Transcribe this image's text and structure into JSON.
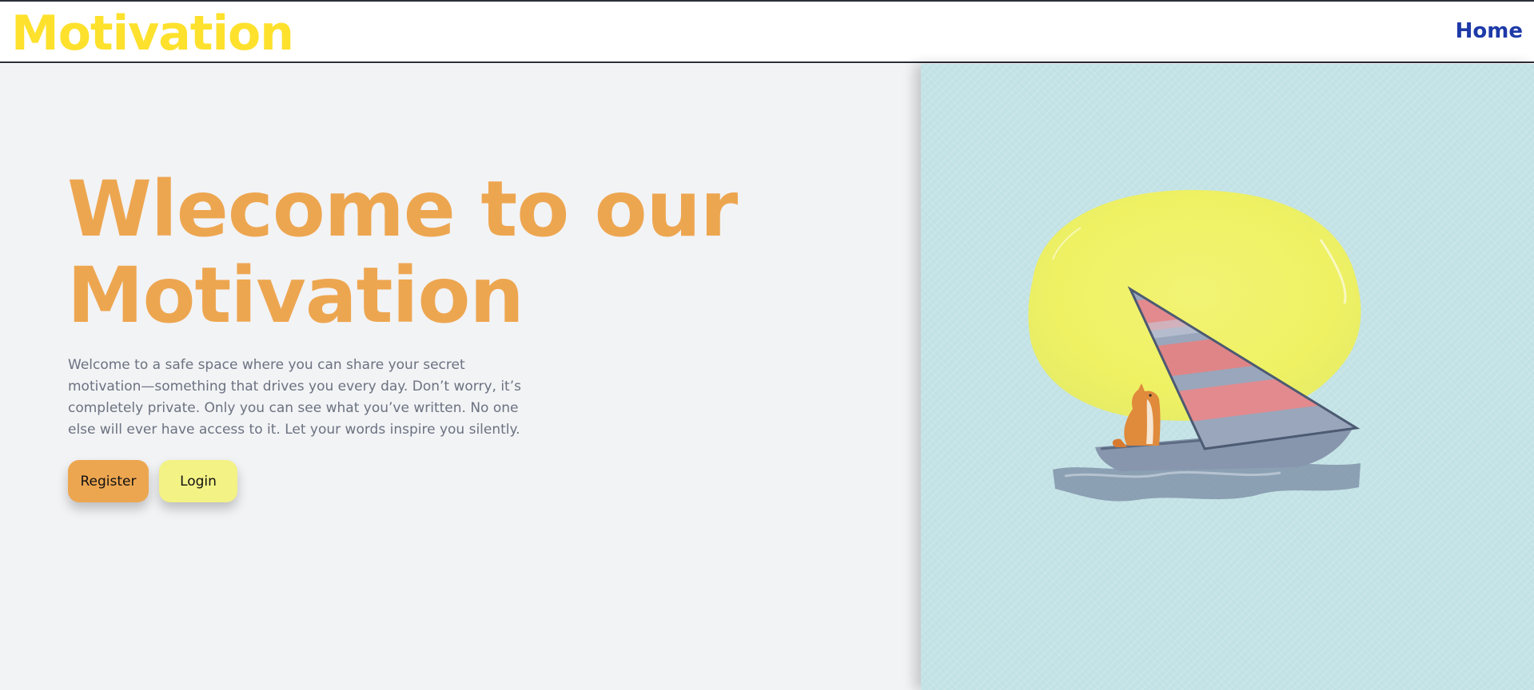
{
  "header": {
    "brand": "Motivation",
    "nav_home": "Home",
    "brand_color": "#fde12d",
    "nav_color": "#1e3aa8"
  },
  "hero": {
    "title": "Wlecome to our Motivation",
    "description": "Welcome to a safe space where you can share your secret motivation—something that drives you every day. Don’t worry, it’s completely private. Only you can see what you’ve written. No one else will ever have access to it. Let your words inspire you silently.",
    "title_color": "#eda650"
  },
  "actions": {
    "register_label": "Register",
    "login_label": "Login",
    "register_color": "#eda650",
    "login_color": "#f3f285"
  },
  "illustration": {
    "icon": "sailboat-fox-illustration",
    "background_color": "#c4e3e6",
    "sun_color": "#f3f36a"
  }
}
